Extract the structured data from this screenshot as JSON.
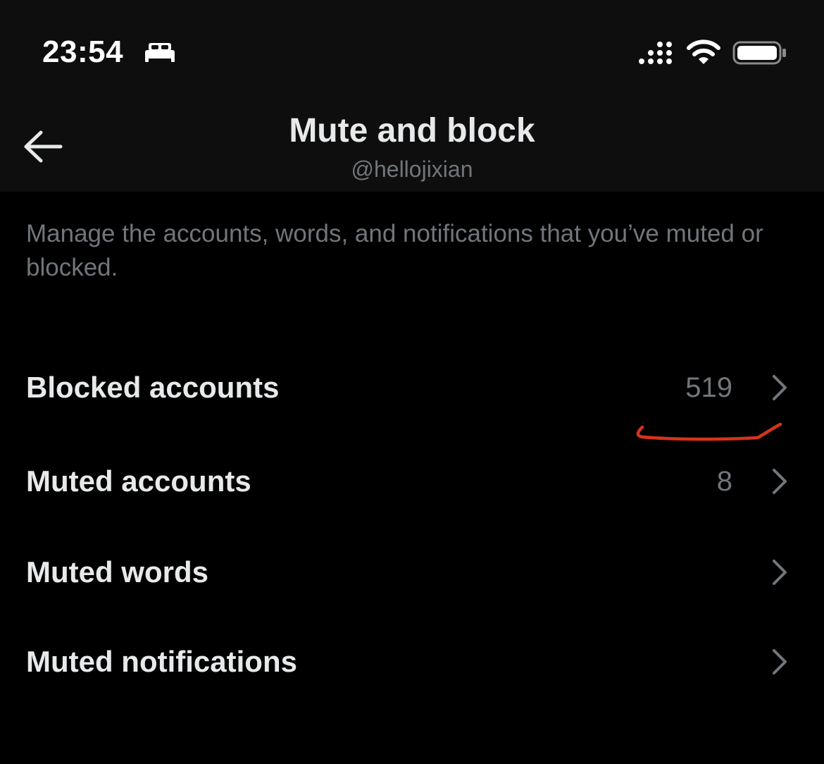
{
  "status_bar": {
    "time": "23:54",
    "focus_icon": "bed-icon",
    "signal_icon": "cellular-signal-icon",
    "wifi_icon": "wifi-icon",
    "battery_icon": "battery-icon"
  },
  "header": {
    "back_icon": "arrow-left-icon",
    "title": "Mute and block",
    "subtitle": "@hellojixian"
  },
  "description": "Manage the accounts, words, and notifications that you’ve muted or blocked.",
  "menu": [
    {
      "label": "Blocked accounts",
      "count": "519"
    },
    {
      "label": "Muted accounts",
      "count": "8"
    },
    {
      "label": "Muted words",
      "count": ""
    },
    {
      "label": "Muted notifications",
      "count": ""
    }
  ],
  "colors": {
    "background": "#000000",
    "header_background": "#0e0e0e",
    "primary_text": "#e7e9ea",
    "secondary_text": "#71767b",
    "annotation": "#d8321c"
  }
}
